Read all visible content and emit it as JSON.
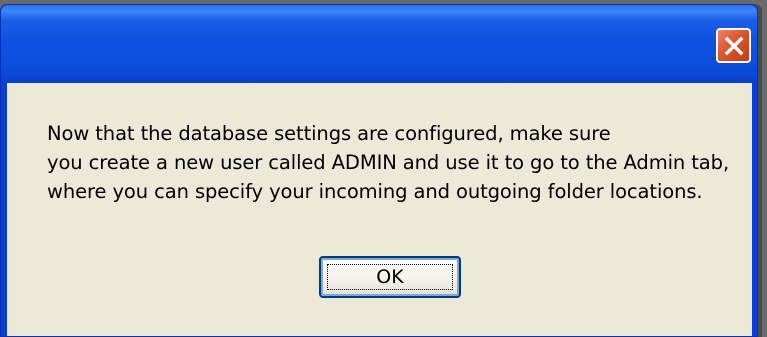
{
  "dialog": {
    "title": "",
    "message_lines": [
      "Now that the database settings are configured, make sure",
      "you create a new user called ADMIN and use it to go to the Admin tab,",
      "where you can specify your incoming and outgoing folder locations."
    ],
    "ok_label": "OK",
    "close_icon": "close-icon"
  },
  "colors": {
    "titlebar": "#0c4fdf",
    "close_button": "#d9562f",
    "client_background": "#ece9d8",
    "desktop": "#6a6a6a"
  }
}
